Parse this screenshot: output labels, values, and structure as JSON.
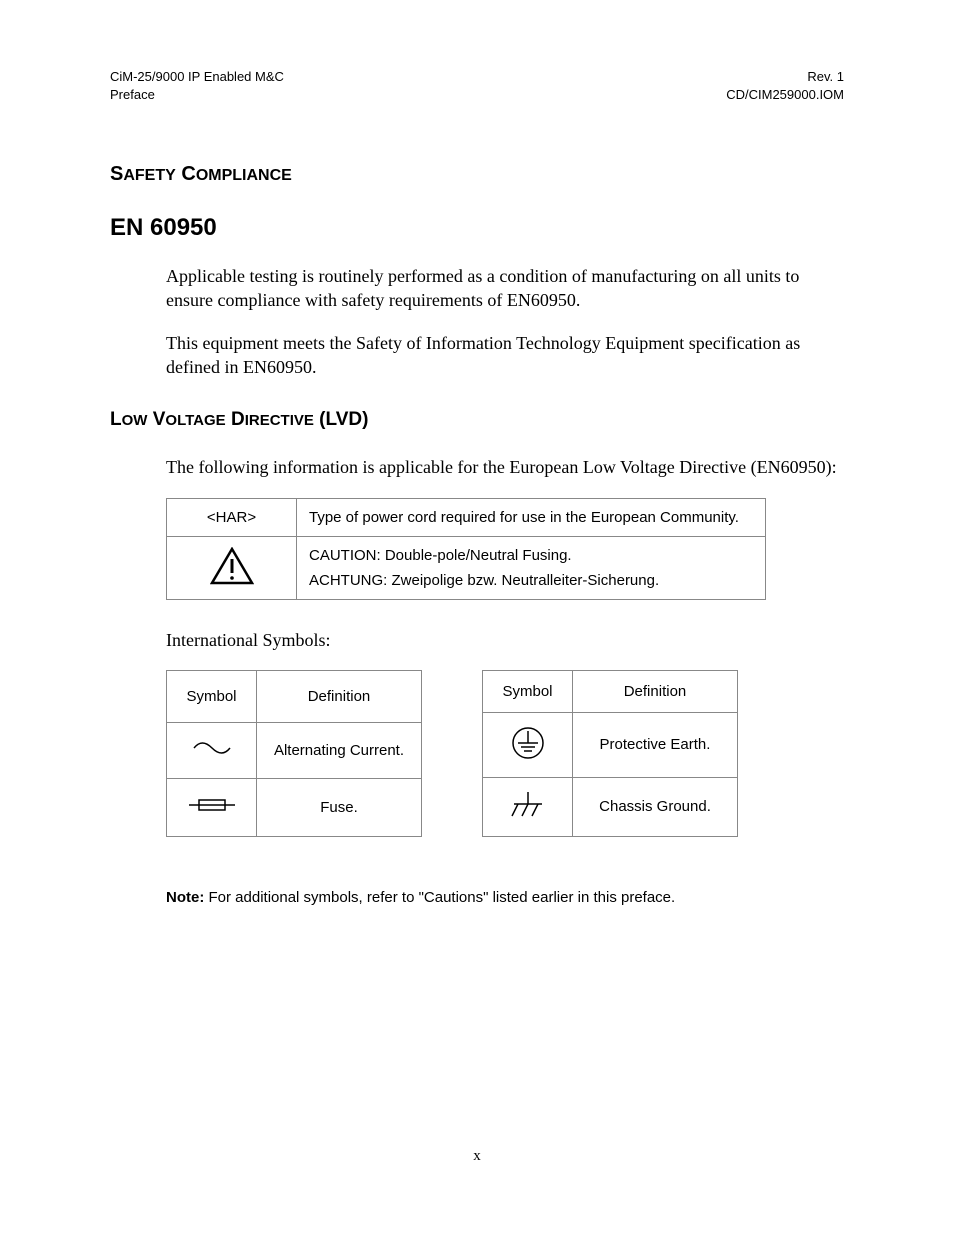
{
  "header": {
    "left_line1": "CiM-25/9000 IP Enabled M&C",
    "left_line2": "Preface",
    "right_line1": "Rev. 1",
    "right_line2": "CD/CIM259000.IOM"
  },
  "headings": {
    "safety_compliance_caps1": "S",
    "safety_compliance_sc1": "AFETY",
    "safety_compliance_caps2": "C",
    "safety_compliance_sc2": "OMPLIANCE",
    "en60950": "EN 60950",
    "lvd_caps1": "L",
    "lvd_sc1": "OW",
    "lvd_caps2": "V",
    "lvd_sc2": "OLTAGE",
    "lvd_caps3": "D",
    "lvd_sc3": "IRECTIVE",
    "lvd_paren": "(LVD)"
  },
  "paragraphs": {
    "p1": "Applicable testing is routinely performed as a condition of manufacturing on all units to ensure compliance with safety requirements of EN60950.",
    "p2": "This equipment meets the Safety of Information Technology Equipment specification as defined in EN60950.",
    "p3": "The following information is applicable for the European Low Voltage Directive (EN60950):",
    "intl_symbols": "International Symbols:"
  },
  "table1": {
    "r1c1": "<HAR>",
    "r1c2": "Type of power cord required for use in the European Community.",
    "r2_icon": "caution-triangle-icon",
    "r2c2a": "CAUTION: Double-pole/Neutral Fusing.",
    "r2c2b": "ACHTUNG: Zweipolige bzw. Neutralleiter-Sicherung."
  },
  "symtable_headers": {
    "symbol": "Symbol",
    "definition": "Definition"
  },
  "symtable_left": [
    {
      "icon": "ac-wave-icon",
      "definition": "Alternating Current."
    },
    {
      "icon": "fuse-icon",
      "definition": "Fuse."
    }
  ],
  "symtable_right": [
    {
      "icon": "protective-earth-icon",
      "definition": "Protective Earth."
    },
    {
      "icon": "chassis-ground-icon",
      "definition": "Chassis Ground."
    }
  ],
  "note": {
    "label": "Note:",
    "text": " For additional symbols, refer to \"Cautions\" listed earlier in this preface."
  },
  "page_number": "x"
}
